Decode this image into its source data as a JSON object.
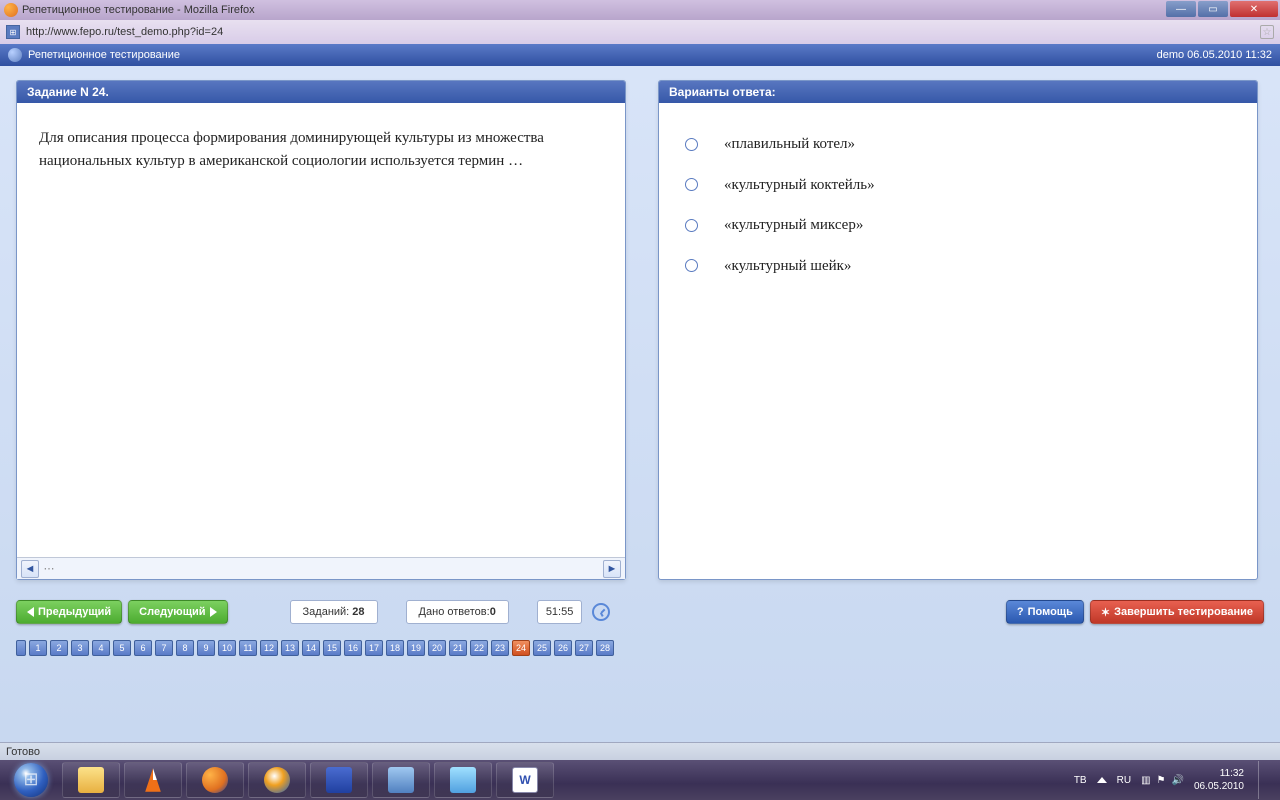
{
  "window": {
    "title": "Репетиционное тестирование - Mozilla Firefox"
  },
  "urlbar": {
    "url": "http://www.fepo.ru/test_demo.php?id=24"
  },
  "app": {
    "title": "Репетиционное тестирование",
    "session": "demo 06.05.2010 11:32"
  },
  "question": {
    "header": "Задание N 24.",
    "text": "Для описания процесса формирования доминирующей культуры из множества национальных культур в американской социологии используется термин …"
  },
  "answers": {
    "header": "Варианты ответа:",
    "items": [
      "«плавильный котел»",
      "«культурный коктейль»",
      "«культурный миксер»",
      "«культурный шейк»"
    ]
  },
  "toolbar": {
    "prev": "Предыдущий",
    "next": "Следующий",
    "tasks_label": "Заданий:",
    "tasks_count": "28",
    "answered_label": "Дано ответов:",
    "answered_count": "0",
    "timer": "51:55",
    "help": "Помощь",
    "finish": "Завершить тестирование"
  },
  "pager": {
    "total": 28,
    "current": 24
  },
  "status": {
    "text": "Готово"
  },
  "tray": {
    "tb": "TB",
    "lang": "RU",
    "time": "11:32",
    "date": "06.05.2010"
  }
}
